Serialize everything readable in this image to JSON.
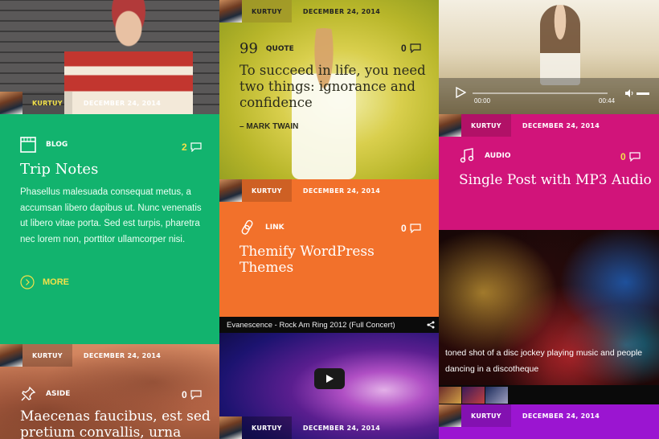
{
  "col1": {
    "top_meta": {
      "author": "KURTUY",
      "date": "DECEMBER 24, 2014"
    },
    "blog": {
      "category": "BLOG",
      "comments": "2",
      "title": "Trip Notes",
      "excerpt": "Phasellus malesuada consequat metus, a accumsan libero dapibus ut. Nunc venenatis ut libero vitae porta. Sed est turpis, pharetra nec lorem non, porttitor ullamcorper nisi.",
      "more_label": "MORE"
    },
    "aside_meta": {
      "author": "KURTUY",
      "date": "DECEMBER 24, 2014"
    },
    "aside": {
      "category": "ASIDE",
      "comments": "0",
      "title": "Maecenas faucibus, est sed pretium convallis, urna"
    }
  },
  "col2": {
    "top_meta": {
      "author": "KURTUY",
      "date": "DECEMBER 24, 2014"
    },
    "quote": {
      "category": "QUOTE",
      "mark": "99",
      "comments": "0",
      "text": "To succeed in life, you need two things: ignorance and confidence",
      "author": "– MARK TWAIN"
    },
    "link_meta": {
      "author": "KURTUY",
      "date": "DECEMBER 24, 2014"
    },
    "link": {
      "category": "LINK",
      "comments": "0",
      "title": "Themify WordPress Themes"
    },
    "video": {
      "title": "Evanescence - Rock Am Ring 2012 (Full Concert)"
    },
    "bottom_meta": {
      "author": "KURTUY",
      "date": "DECEMBER 24, 2014"
    }
  },
  "col3": {
    "player": {
      "time_current": "00:00",
      "time_total": "00:44"
    },
    "audio_meta": {
      "author": "KURTUY",
      "date": "DECEMBER 24, 2014"
    },
    "audio": {
      "category": "AUDIO",
      "comments": "0",
      "title": "Single Post with MP3 Audio"
    },
    "gallery": {
      "caption": "toned shot of a disc jockey playing music and people dancing in a discotheque"
    },
    "bottom_meta": {
      "author": "KURTUY",
      "date": "DECEMBER 24, 2014"
    }
  },
  "colors": {
    "green": "#12b36e",
    "orange": "#f2712b",
    "magenta": "#d1147a",
    "purple": "#9b15d1",
    "yellow_text": "#f2e14a"
  }
}
